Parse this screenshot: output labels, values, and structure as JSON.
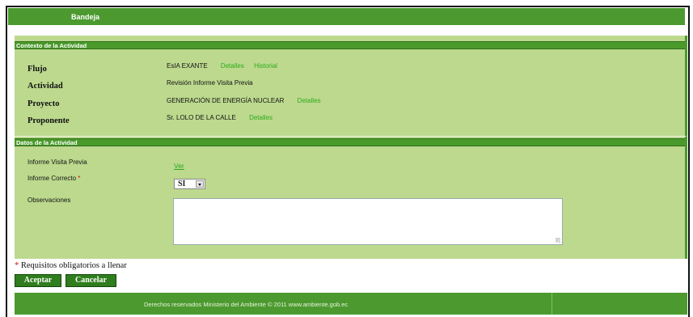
{
  "tab": {
    "label": "Bandeja"
  },
  "context": {
    "header": "Contexto de la Actividad",
    "rows": [
      {
        "label": "Flujo",
        "value": "EsIA EXANTE",
        "links": [
          "Detalles",
          "Historial"
        ]
      },
      {
        "label": "Actividad",
        "value": "Revisión Informe Visita Previa",
        "links": []
      },
      {
        "label": "Proyecto",
        "value": "GENERACIÓN DE ENERGÍA NUCLEAR",
        "links": [
          "Detalles"
        ]
      },
      {
        "label": "Proponente",
        "value": "Sr. LOLO DE LA CALLE",
        "links": [
          "Detalles"
        ]
      }
    ]
  },
  "activity": {
    "header": "Datos de la Actividad",
    "informe_label": "Informe Visita Previa",
    "ver_link": "Ver",
    "correcto_label": "Informe Correcto",
    "required_mark": "*",
    "correcto_value": "SI",
    "observaciones_label": "Observaciones",
    "observaciones_value": ""
  },
  "required_note": "Requisitos obligatorios a llenar",
  "buttons": {
    "accept": "Aceptar",
    "cancel": "Cancelar"
  },
  "footer": {
    "text": "Derechos reservados Ministerio del Ambiente © 2011 www.ambiente.gob.ec"
  },
  "colors": {
    "header_green": "#4c9a2f",
    "panel_green": "#bcd98e",
    "link_green": "#2eaa1a",
    "required_red": "#d01010"
  }
}
